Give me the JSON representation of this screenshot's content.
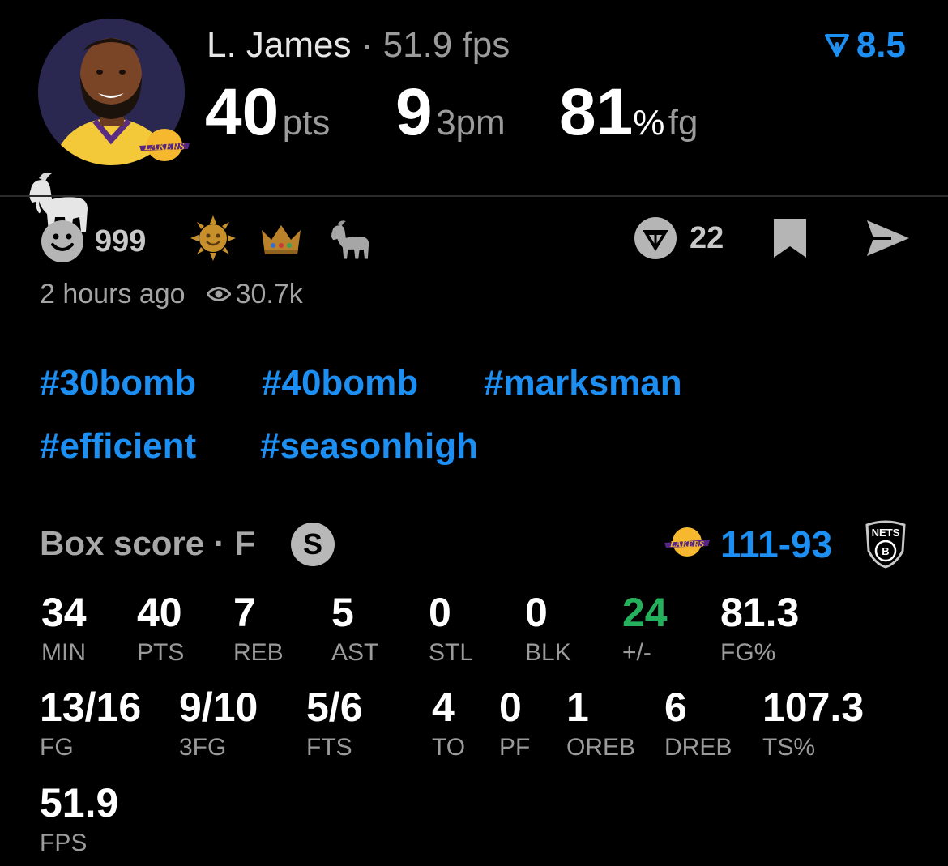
{
  "header": {
    "player_name": "L. James",
    "separator": "·",
    "player_fps": "51.9 fps",
    "rating": "8.5",
    "points": "40",
    "points_unit": "pts",
    "threes": "9",
    "threes_unit": "3pm",
    "fg_pct": "81",
    "fg_pct_sign": "%",
    "fg_unit": "fg"
  },
  "reactions": {
    "like_count": "999",
    "icons": [
      "smiley-icon",
      "sun-icon",
      "crown-icon",
      "goat-icon"
    ],
    "comment_count": "22"
  },
  "meta": {
    "time_ago": "2 hours ago",
    "views": "30.7k"
  },
  "hashtags": [
    "#30bomb",
    "#40bomb",
    "#marksman",
    "#efficient",
    "#seasonhigh"
  ],
  "box_score": {
    "title": "Box score · F",
    "status_badge": "S",
    "home_score": "111",
    "score_dash": "-",
    "away_score": "93",
    "away_team_logo": "NETS",
    "row1": [
      {
        "value": "34",
        "label": "MIN"
      },
      {
        "value": "40",
        "label": "PTS"
      },
      {
        "value": "7",
        "label": "REB"
      },
      {
        "value": "5",
        "label": "AST"
      },
      {
        "value": "0",
        "label": "STL"
      },
      {
        "value": "0",
        "label": "BLK"
      },
      {
        "value": "24",
        "label": "+/-"
      },
      {
        "value": "81.3",
        "label": "FG%"
      }
    ],
    "row2": [
      {
        "value": "13/16",
        "label": "FG"
      },
      {
        "value": "9/10",
        "label": "3FG"
      },
      {
        "value": "5/6",
        "label": "FTS"
      },
      {
        "value": "4",
        "label": "TO"
      },
      {
        "value": "0",
        "label": "PF"
      },
      {
        "value": "1",
        "label": "OREB"
      },
      {
        "value": "6",
        "label": "DREB"
      },
      {
        "value": "107.3",
        "label": "TS%"
      }
    ],
    "row3": [
      {
        "value": "51.9",
        "label": "FPS"
      }
    ]
  },
  "colors": {
    "accent": "#1d8ff2",
    "positive": "#25b05c",
    "background": "#000000"
  }
}
